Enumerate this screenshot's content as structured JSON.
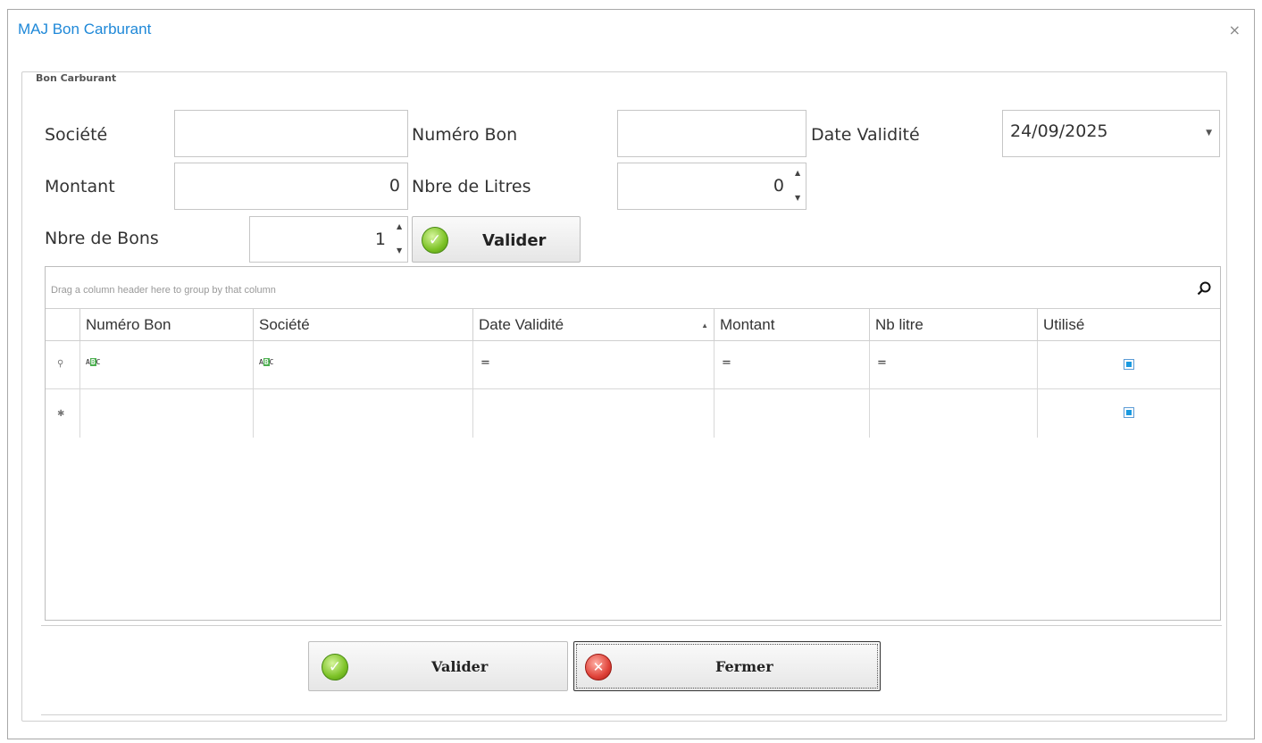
{
  "window": {
    "title": "MAJ Bon Carburant",
    "close_glyph": "×"
  },
  "group": {
    "legend": "Bon Carburant"
  },
  "form": {
    "societe_label": "Société",
    "societe_value": "",
    "numero_bon_label": "Numéro Bon",
    "numero_bon_value": "",
    "date_validite_label": "Date Validité",
    "date_validite_value": "24/09/2025",
    "montant_label": "Montant",
    "montant_value": "0",
    "nbre_litres_label": "Nbre de Litres",
    "nbre_litres_value": "0",
    "nbre_bons_label": "Nbre de Bons",
    "nbre_bons_value": "1",
    "valider_label": "Valider"
  },
  "grid": {
    "group_hint": "Drag a column header here to group by that column",
    "columns": [
      "Numéro Bon",
      "Société",
      "Date Validité",
      "Montant",
      "Nb litre",
      "Utilisé"
    ],
    "sorted_column": "Date Validité",
    "sort_direction": "ascending",
    "filter_row": {
      "indicator": "⚲",
      "text_symbol": "ABC",
      "eq_symbol": "=",
      "utilise_checked": true
    },
    "new_row": {
      "indicator": "✱",
      "utilise_checked": true
    }
  },
  "footer": {
    "valider_label": "Valider",
    "fermer_label": "Fermer"
  },
  "colors": {
    "title": "#1e88d8",
    "checkbox": "#1a9ae0"
  }
}
